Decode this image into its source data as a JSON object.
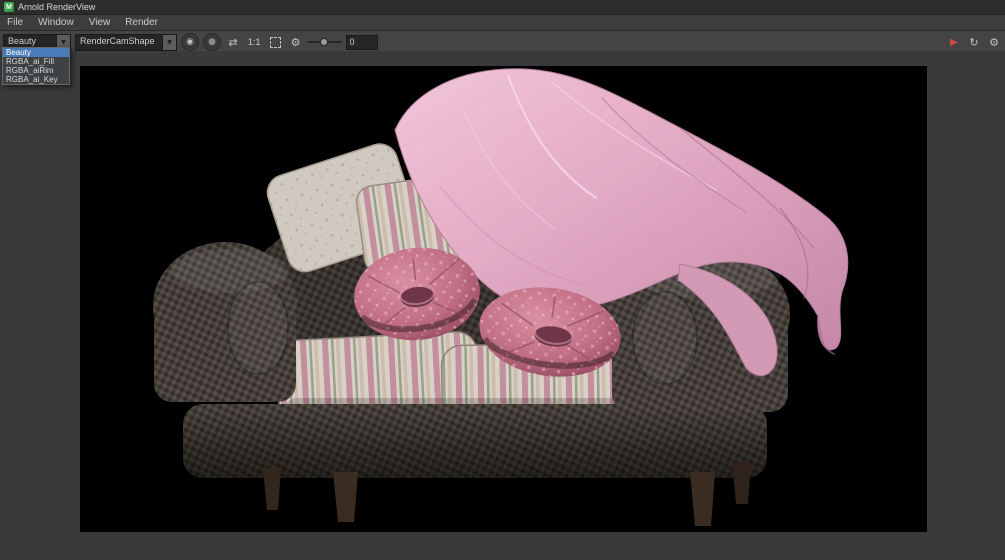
{
  "window": {
    "title": "Arnold RenderView"
  },
  "menu": {
    "items": [
      {
        "label": "File"
      },
      {
        "label": "Window"
      },
      {
        "label": "View"
      },
      {
        "label": "Render"
      }
    ]
  },
  "toolbar": {
    "aov": {
      "value": "Beauty",
      "options": [
        "Beauty",
        "RGBA_ai_Fill",
        "RGBA_aiRim",
        "RGBA_ai_Key"
      ],
      "selected_index": 0
    },
    "camera": {
      "value": "RenderCamShape"
    },
    "zoom_ratio": "1:1",
    "exposure": "0"
  },
  "icons": {
    "dropdown_arrow": "▼",
    "target": "◉",
    "dot": "●",
    "swap": "⇄",
    "gear": "⚙",
    "play": "▶",
    "refresh": "↻"
  },
  "colors": {
    "selection_highlight": "#4a7ab7",
    "record_red": "#cf4840",
    "maya_green": "#3fa14c",
    "blanket_pink": "#e3aac4",
    "pillow_pink": "#c06e84"
  }
}
